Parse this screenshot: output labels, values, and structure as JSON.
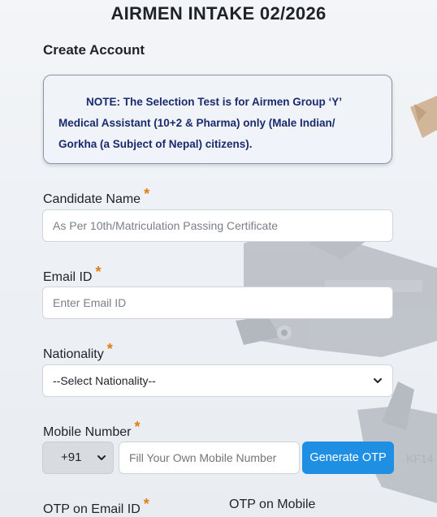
{
  "header": {
    "title": "AIRMEN INTAKE 02/2026",
    "subtitle": "Create Account"
  },
  "note": {
    "text_line1": "NOTE: The Selection Test is for Airmen Group ‘Y’",
    "text_line2": "Medical Assistant (10+2 & Pharma) only (Male Indian/",
    "text_line3": "Gorkha (a Subject of Nepal) citizens)."
  },
  "form": {
    "required_mark": "*",
    "candidate_name": {
      "label": "Candidate Name",
      "placeholder": "As Per 10th/Matriculation Passing Certificate"
    },
    "email": {
      "label": "Email ID",
      "placeholder": "Enter Email ID"
    },
    "nationality": {
      "label": "Nationality",
      "selected": "--Select Nationality--"
    },
    "mobile": {
      "label": "Mobile Number",
      "country_code": "+91",
      "placeholder": "Fill Your Own Mobile Number",
      "button": "Generate OTP"
    },
    "otp_email": {
      "label": "OTP on Email ID"
    },
    "otp_mobile": {
      "label": "OTP on Mobile"
    }
  },
  "colors": {
    "accent_button": "#1e8fe3",
    "note_text": "#1a2a6c",
    "required": "#e07d14"
  },
  "icons": [
    "chevron-down-icon"
  ]
}
